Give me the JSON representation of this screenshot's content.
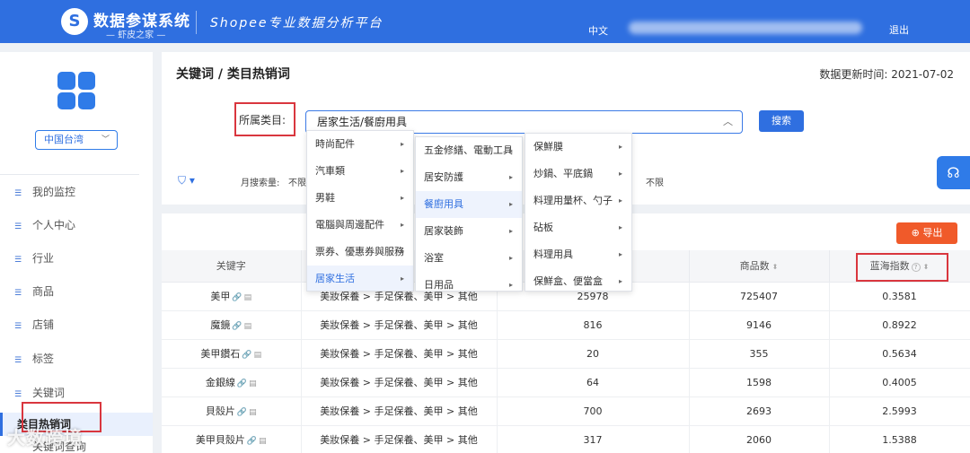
{
  "header": {
    "logo_glyph": "S",
    "app_name": "数据参谋系统",
    "app_sub": "— 虾皮之家 —",
    "slogan": "Shopee专业数据分析平台",
    "language": "中文",
    "logout": "退出"
  },
  "sidebar": {
    "region": "中国台湾",
    "items": [
      {
        "label": "我的监控"
      },
      {
        "label": "个人中心"
      },
      {
        "label": "行业"
      },
      {
        "label": "商品"
      },
      {
        "label": "店铺"
      },
      {
        "label": "标签"
      },
      {
        "label": "关键词"
      },
      {
        "label": "类目热销词"
      },
      {
        "label": "关键词查询"
      }
    ]
  },
  "page": {
    "title": "关键词 / 类目热销词",
    "update_label": "数据更新时间:",
    "update_date": "2021-07-02"
  },
  "filter": {
    "category_label": "所属类目:",
    "category_value": "居家生活/餐廚用具",
    "search_button": "搜索",
    "monthly_label": "月搜索量:",
    "monthly_value": "不限",
    "right_value": "不限"
  },
  "dropdown": {
    "level1": [
      "時尚配件",
      "汽車類",
      "男鞋",
      "電腦與周邊配件",
      "票券、優惠券與服務",
      "居家生活"
    ],
    "level2": [
      "五金修繕、電動工具",
      "居安防護",
      "餐廚用具",
      "居家裝飾",
      "浴室",
      "日用品"
    ],
    "level3": [
      "保鮮膜",
      "炒鍋、平底鍋",
      "料理用量杯、勺子",
      "砧板",
      "料理用具",
      "保鮮盒、便當盒"
    ]
  },
  "table": {
    "export_label": "导出",
    "headers": {
      "keyword": "关键字",
      "category": "",
      "searches": "",
      "products": "商品数",
      "blue_ocean": "蓝海指数"
    },
    "rows": [
      {
        "keyword": "美甲",
        "category": "美妝保養 > 手足保養、美甲 > 其他",
        "searches": "25978",
        "products": "725407",
        "index": "0.3581"
      },
      {
        "keyword": "魔鏡",
        "category": "美妝保養 > 手足保養、美甲 > 其他",
        "searches": "816",
        "products": "9146",
        "index": "0.8922"
      },
      {
        "keyword": "美甲鑽石",
        "category": "美妝保養 > 手足保養、美甲 > 其他",
        "searches": "20",
        "products": "355",
        "index": "0.5634"
      },
      {
        "keyword": "金銀線",
        "category": "美妝保養 > 手足保養、美甲 > 其他",
        "searches": "64",
        "products": "1598",
        "index": "0.4005"
      },
      {
        "keyword": "貝殼片",
        "category": "美妝保養 > 手足保養、美甲 > 其他",
        "searches": "700",
        "products": "2693",
        "index": "2.5993"
      },
      {
        "keyword": "美甲貝殼片",
        "category": "美妝保養 > 手足保養、美甲 > 其他",
        "searches": "317",
        "products": "2060",
        "index": "1.5388"
      }
    ]
  },
  "watermark": "大数跨境"
}
